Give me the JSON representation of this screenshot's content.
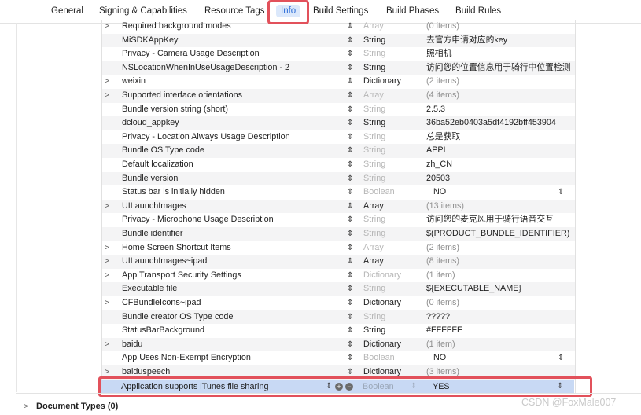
{
  "tabs": [
    {
      "label": "General"
    },
    {
      "label": "Signing & Capabilities"
    },
    {
      "label": "Resource Tags"
    },
    {
      "label": "Info"
    },
    {
      "label": "Build Settings"
    },
    {
      "label": "Build Phases"
    },
    {
      "label": "Build Rules"
    }
  ],
  "rows": [
    {
      "key": "Required background modes",
      "type": "Array",
      "value": "(0 items)"
    },
    {
      "key": "MiSDKAppKey",
      "type": "String",
      "value": "去官方申请对应的key"
    },
    {
      "key": "Privacy - Camera Usage Description",
      "type": "String",
      "value": "照相机"
    },
    {
      "key": "NSLocationWhenInUseUsageDescription - 2",
      "type": "String",
      "value": "访问您的位置信息用于骑行中位置检测"
    },
    {
      "key": "weixin",
      "type": "Dictionary",
      "value": "(2 items)"
    },
    {
      "key": "Supported interface orientations",
      "type": "Array",
      "value": "(4 items)"
    },
    {
      "key": "Bundle version string (short)",
      "type": "String",
      "value": "2.5.3"
    },
    {
      "key": "dcloud_appkey",
      "type": "String",
      "value": "36ba52eb0403a5df4192bff453904"
    },
    {
      "key": "Privacy - Location Always Usage Description",
      "type": "String",
      "value": "总是获取"
    },
    {
      "key": "Bundle OS Type code",
      "type": "String",
      "value": "APPL"
    },
    {
      "key": "Default localization",
      "type": "String",
      "value": "zh_CN"
    },
    {
      "key": "Bundle version",
      "type": "String",
      "value": "20503"
    },
    {
      "key": "Status bar is initially hidden",
      "type": "Boolean",
      "value": "NO"
    },
    {
      "key": "UILaunchImages",
      "type": "Array",
      "value": "(13 items)"
    },
    {
      "key": "Privacy - Microphone Usage Description",
      "type": "String",
      "value": "访问您的麦克风用于骑行语音交互"
    },
    {
      "key": "Bundle identifier",
      "type": "String",
      "value": "$(PRODUCT_BUNDLE_IDENTIFIER)"
    },
    {
      "key": "Home Screen Shortcut Items",
      "type": "Array",
      "value": "(2 items)"
    },
    {
      "key": "UILaunchImages~ipad",
      "type": "Array",
      "value": "(8 items)"
    },
    {
      "key": "App Transport Security Settings",
      "type": "Dictionary",
      "value": "(1 item)"
    },
    {
      "key": "Executable file",
      "type": "String",
      "value": "${EXECUTABLE_NAME}"
    },
    {
      "key": "CFBundleIcons~ipad",
      "type": "Dictionary",
      "value": "(0 items)"
    },
    {
      "key": "Bundle creator OS Type code",
      "type": "String",
      "value": "?????"
    },
    {
      "key": "StatusBarBackground",
      "type": "String",
      "value": "#FFFFFF"
    },
    {
      "key": "baidu",
      "type": "Dictionary",
      "value": "(1 item)"
    },
    {
      "key": "App Uses Non-Exempt Encryption",
      "type": "Boolean",
      "value": "NO"
    },
    {
      "key": "baiduspeech",
      "type": "Dictionary",
      "value": "(3 items)"
    }
  ],
  "selected_row": {
    "key": "Application supports iTunes file sharing",
    "type": "Boolean",
    "value": "YES"
  },
  "document_types": {
    "label": "Document Types (0)"
  },
  "watermark": "CSDN @FoxMale007",
  "colors": {
    "selection": "#c8d9f4",
    "highlight": "#e2515b",
    "tab_selected": "#dbe8fb"
  }
}
